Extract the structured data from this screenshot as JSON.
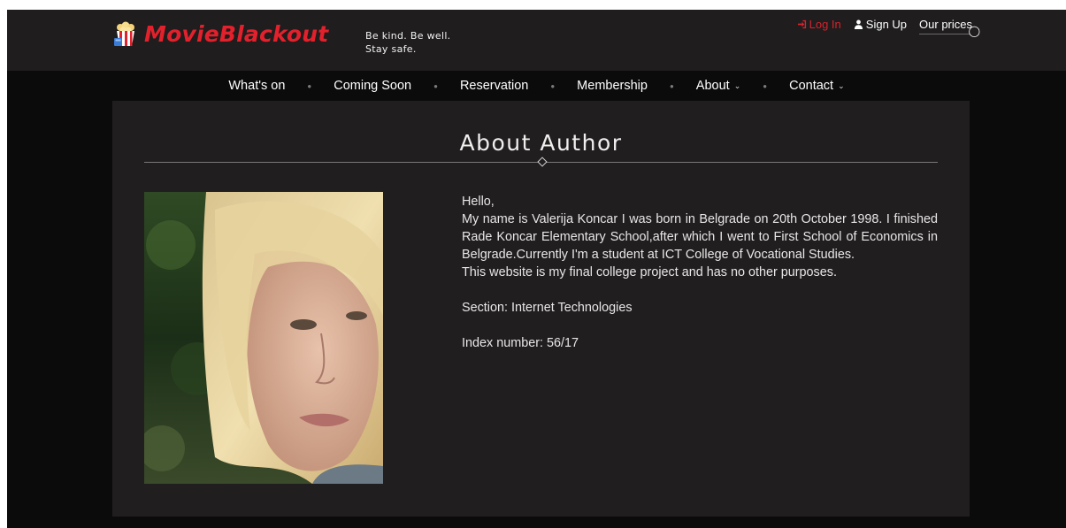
{
  "brand": {
    "name": "MovieBlackout",
    "tagline_line1": "Be kind. Be well.",
    "tagline_line2": "Stay safe."
  },
  "auth": {
    "login_label": "Log In",
    "signup_label": "Sign Up",
    "prices_label": "Our prices"
  },
  "nav": {
    "items": [
      {
        "label": "What's on"
      },
      {
        "label": "Coming Soon"
      },
      {
        "label": "Reservation"
      },
      {
        "label": "Membership"
      },
      {
        "label": "About"
      },
      {
        "label": "Contact"
      }
    ]
  },
  "about": {
    "title": "About Author",
    "greeting": "Hello,",
    "bio_paragraph": "My name is Valerija Koncar I was born in Belgrade on 20th October 1998. I finished Rade Koncar Elementary School,after which I went to First School of Economics in Belgrade.Currently I'm a student at ICT College of Vocational Studies.",
    "purpose": "This website is my final college project and has no other purposes.",
    "section": "Section: Internet Technologies",
    "index": "Index number: 56/17"
  },
  "colors": {
    "accent": "#e3212c",
    "topbar": "#1f1d1d",
    "page_bg": "#0c0b0b",
    "panel_bg": "#211e1f"
  },
  "icons": {
    "logo": "popcorn-icon",
    "login": "sign-in-icon",
    "signup": "user-icon",
    "prices": "coin-icon",
    "nav_dropdown": "chevron-down-icon"
  }
}
